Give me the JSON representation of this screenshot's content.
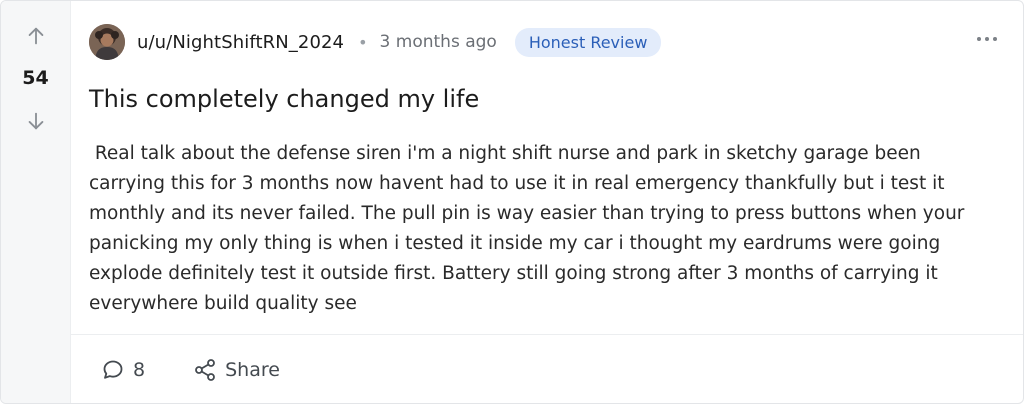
{
  "vote": {
    "count": "54"
  },
  "post": {
    "username": "u/u/NightShiftRN_2024",
    "separator": "•",
    "time": "3 months ago",
    "flair": "Honest Review",
    "title": "This completely changed my life",
    "body": " Real talk about the defense siren i'm a night shift nurse and park in sketchy garage been carrying this for 3 months now havent had to use it in real emergency thankfully but i test it monthly and its never failed. The pull pin is way easier than trying to press buttons when your panicking my only thing is when i tested it inside my car i thought my eardrums were going explode definitely test it outside first. Battery still going strong after 3 months of carrying it everywhere build quality see"
  },
  "actions": {
    "comments_count": "8",
    "share_label": "Share"
  },
  "icons": {
    "upvote": "arrow-up-icon",
    "downvote": "arrow-down-icon",
    "more": "more-horizontal-icon",
    "comment": "comment-bubble-icon",
    "share": "share-icon"
  },
  "colors": {
    "flair_bg": "#e3ecfb",
    "flair_text": "#2b5fb8",
    "vote_column_bg": "#f6f7f8"
  }
}
